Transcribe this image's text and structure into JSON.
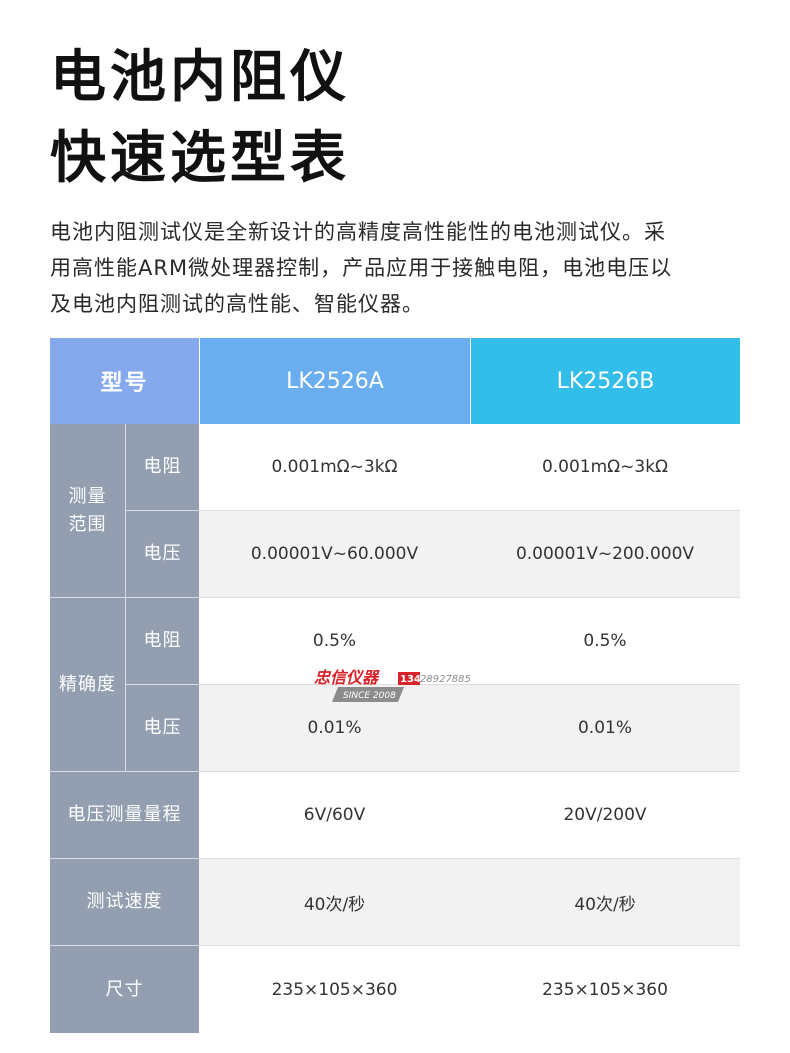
{
  "title": {
    "line1": "电池内阻仪",
    "line2": "快速选型表"
  },
  "description": {
    "line1": "电池内阻测试仪是全新设计的高精度高性能性的电池测试仪。采",
    "line2": "用高性能ARM微处理器控制，产品应用于接触电阻，电池电压以",
    "line3": "及电池内阻测试的高性能、智能仪器。"
  },
  "table": {
    "header": {
      "label": "型号",
      "model_a": "LK2526A",
      "model_b": "LK2526B"
    },
    "groups": {
      "range": {
        "label_line1": "测量",
        "label_line2": "范围",
        "resistance": {
          "label": "电阻",
          "a": "0.001mΩ~3kΩ",
          "b": "0.001mΩ~3kΩ"
        },
        "voltage": {
          "label": "电压",
          "a": "0.00001V~60.000V",
          "b": "0.00001V~200.000V"
        }
      },
      "accuracy": {
        "label": "精确度",
        "resistance": {
          "label": "电阻",
          "a": "0.5%",
          "b": "0.5%"
        },
        "voltage": {
          "label": "电压",
          "a": "0.01%",
          "b": "0.01%"
        }
      }
    },
    "rows": {
      "voltage_range": {
        "label": "电压测量量程",
        "a": "6V/60V",
        "b": "20V/200V"
      },
      "test_speed": {
        "label": "测试速度",
        "a": "40次/秒",
        "b": "40次/秒"
      },
      "size": {
        "label": "尺寸",
        "a": "235×105×360",
        "b": "235×105×360"
      }
    }
  },
  "watermark": {
    "brand": "忠信仪器",
    "since": "SINCE 2008",
    "phone_prefix": "134",
    "phone_rest": "28927885"
  },
  "colors": {
    "header_label": "#86a9ee",
    "header_a": "#6aaef0",
    "header_b": "#33bde9",
    "side": "#939fb1",
    "watermark_red": "#d9232a"
  }
}
